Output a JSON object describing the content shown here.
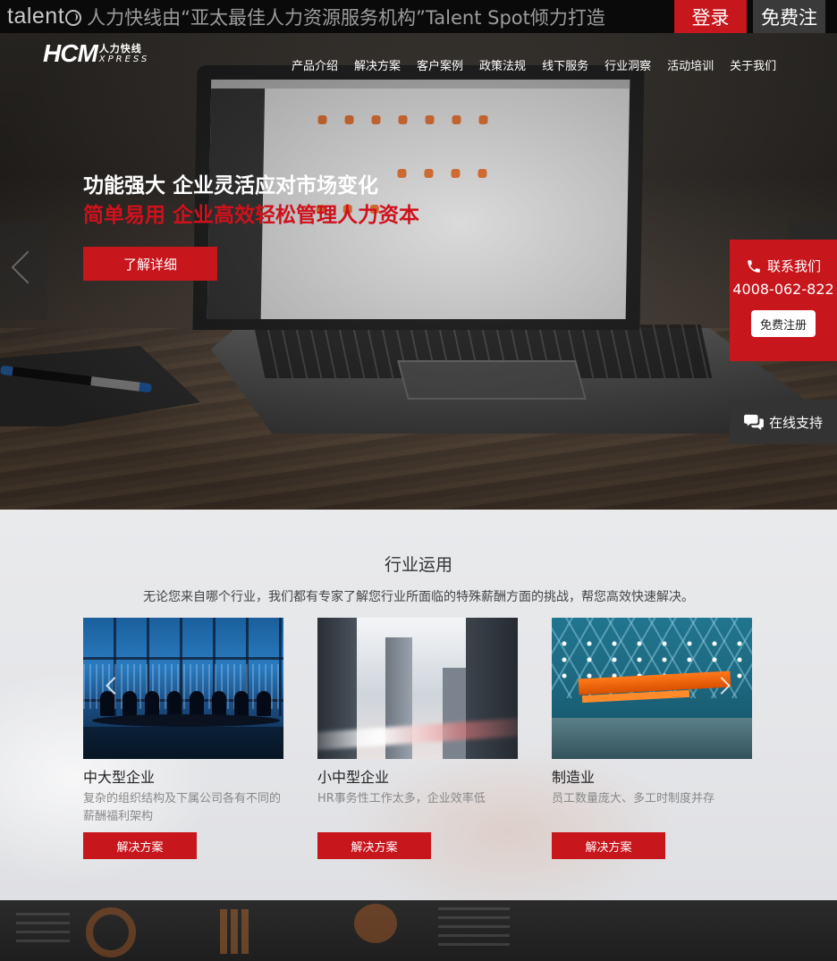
{
  "topbar": {
    "logo_text": "talent",
    "slogan": "人力快线由“亚太最佳人力资源服务机构”Talent Spot倾力打造",
    "login_label": "登录",
    "register_label": "免费注"
  },
  "brand": {
    "logo_main": "HCM",
    "logo_cn": "人力快线",
    "logo_en": "XPRESS"
  },
  "nav": {
    "items": [
      "产品介绍",
      "解决方案",
      "客户案例",
      "政策法规",
      "线下服务",
      "行业洞察",
      "活动培训",
      "关于我们"
    ]
  },
  "hero": {
    "line1": "功能强大 企业灵活应对市场变化",
    "line2": "简单易用 企业高效轻松管理人力资本",
    "button_label": "了解详细",
    "accent_color": "#c8161d"
  },
  "contact": {
    "title": "联系我们",
    "phone": "4008-062-822",
    "register_label": "免费注册",
    "support_label": "在线支持"
  },
  "industry": {
    "title": "行业运用",
    "description": "无论您来自哪个行业，我们都有专家了解您行业所面临的特殊薪酬方面的挑战，帮您高效快速解决。",
    "cards": [
      {
        "name": "中大型企业",
        "text": "复杂的组织结构及下属公司各有不同的薪酬福利架构",
        "button_label": "解决方案"
      },
      {
        "name": "小中型企业",
        "text": "HR事务性工作太多，企业效率低",
        "button_label": "解决方案"
      },
      {
        "name": "制造业",
        "text": "员工数量庞大、多工时制度并存",
        "button_label": "解决方案"
      }
    ]
  }
}
